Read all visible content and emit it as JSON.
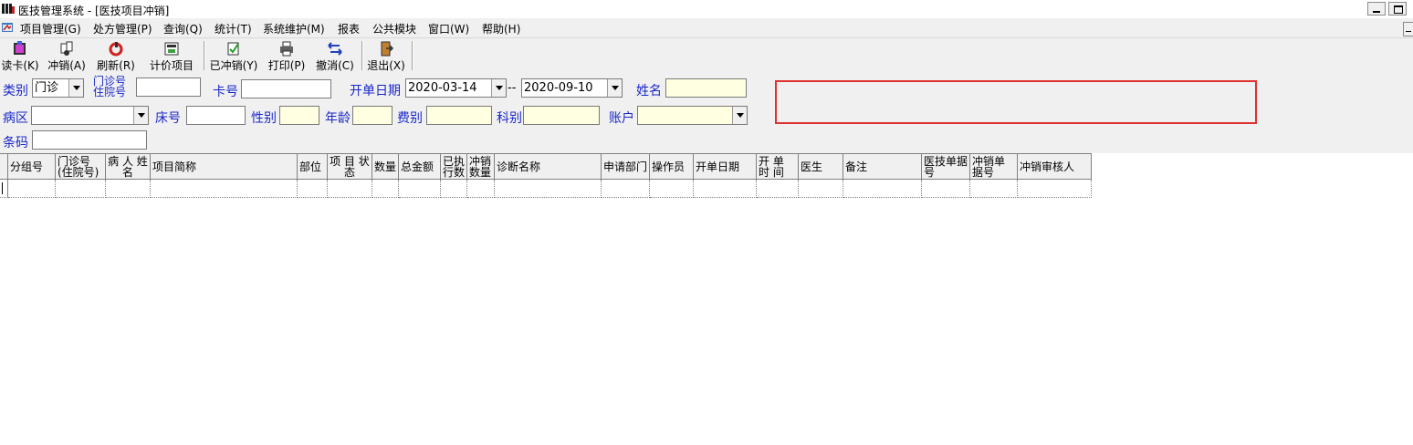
{
  "window": {
    "title": "医技管理系统 - [医技项目冲销]"
  },
  "menu": [
    "项目管理(G)",
    "处方管理(P)",
    "查询(Q)",
    "统计(T)",
    "系统维护(M)",
    "报表",
    "公共模块",
    "窗口(W)",
    "帮助(H)"
  ],
  "toolbar": [
    {
      "label": "读卡(K)",
      "icon": "card-reader-icon"
    },
    {
      "label": "冲销(A)",
      "icon": "writeoff-icon"
    },
    {
      "label": "刷新(R)",
      "icon": "refresh-icon"
    },
    {
      "label": "计价项目",
      "icon": "pricing-icon"
    },
    {
      "label": "已冲销(Y)",
      "icon": "written-off-icon"
    },
    {
      "label": "打印(P)",
      "icon": "printer-icon"
    },
    {
      "label": "撤消(C)",
      "icon": "undo-icon"
    },
    {
      "label": "退出(X)",
      "icon": "exit-icon"
    }
  ],
  "form": {
    "category_label": "类别",
    "category_value": "门诊",
    "outpatient_label_1": "门诊号",
    "outpatient_label_2": "住院号",
    "outpatient_value": "",
    "card_label": "卡号",
    "card_value": "",
    "date_label": "开单日期",
    "date_from": "2020-03-14",
    "date_sep": "--",
    "date_to": "2020-09-10",
    "name_label": "姓名",
    "name_value": "",
    "ward_label": "病区",
    "ward_value": "",
    "bed_label": "床号",
    "bed_value": "",
    "gender_label": "性别",
    "gender_value": "",
    "age_label": "年龄",
    "age_value": "",
    "fee_label": "费别",
    "fee_value": "",
    "dept_label": "科别",
    "dept_value": "",
    "account_label": "账户",
    "account_value": "",
    "barcode_label": "条码",
    "barcode_value": ""
  },
  "grid": {
    "columns": [
      "分组号",
      "门诊号(住院号)",
      "病 人 姓 名",
      "项目简称",
      "部位",
      "项 目 状 态",
      "数量",
      "总金额",
      "已执行数",
      "冲销数量",
      "诊断名称",
      "申请部门",
      "操作员",
      "开单日期",
      "开 单 时 间",
      "医生",
      "备注",
      "医技单据号",
      "冲销单据号",
      "冲销审核人"
    ],
    "rows": []
  },
  "colors": {
    "label_blue": "#1a28c8",
    "field_yellow": "#ffffe1",
    "highlight_red": "#e03030"
  }
}
